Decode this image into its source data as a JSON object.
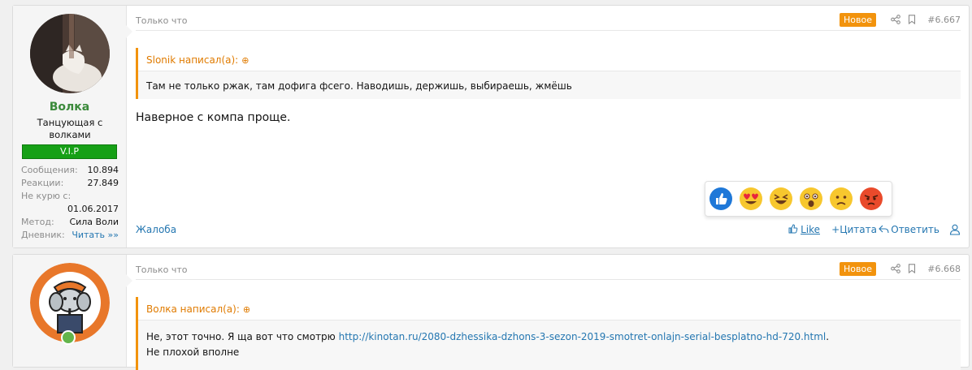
{
  "posts": [
    {
      "user": {
        "name": "Волка",
        "title": "Танцующая с волками",
        "banner": "V.I.P",
        "stats": [
          {
            "key": "Сообщения:",
            "value": "10.894"
          },
          {
            "key": "Реакции:",
            "value": "27.849"
          },
          {
            "key": "Не курю с:",
            "value": ""
          },
          {
            "key": "",
            "value": "01.06.2017"
          },
          {
            "key": "Метод:",
            "value": "Сила Воли"
          },
          {
            "key": "Дневник:",
            "value": "Читать »»"
          }
        ]
      },
      "time": "Только что",
      "badge": "Новое",
      "number": "#6.667",
      "quote": {
        "author": "Slonik написал(а):",
        "text": "Там не только ржак, там дофига фсего. Наводишь, держишь, выбираешь, жмёшь"
      },
      "message": "Наверное с компа проще.",
      "reactions": [
        "like",
        "love",
        "haha",
        "wow",
        "sad",
        "angry"
      ],
      "report": "Жалоба",
      "actions": {
        "like": "Like",
        "quote": "Цитата",
        "reply": "Ответить"
      }
    },
    {
      "time": "Только что",
      "badge": "Новое",
      "number": "#6.668",
      "quote": {
        "author": "Волка написал(а):",
        "text_before": "Не, этот точно. Я ща вот что смотрю ",
        "link": "http://kinotan.ru/2080-dzhessika-dzhons-3-sezon-2019-smotret-onlajn-serial-besplatno-hd-720.html",
        "text_after": ".",
        "line2": "Не плохой вполне"
      }
    }
  ],
  "colors": {
    "accent": "#f2930d",
    "link": "#2577b1",
    "vip": "#16a016",
    "username": "#3b8a3b"
  }
}
